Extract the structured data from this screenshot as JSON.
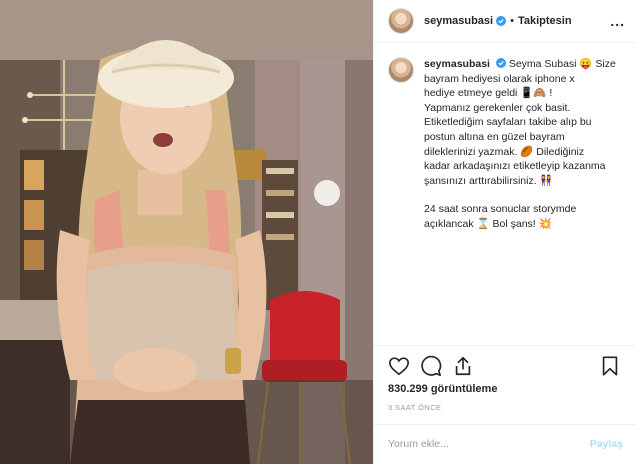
{
  "post": {
    "username": "seymasubasi",
    "separator": "•",
    "follow_label": "Takiptesin",
    "more_label": "...",
    "icons": {
      "verified": "verified-badge-icon",
      "like": "heart-icon",
      "comment": "comment-bubble-icon",
      "share": "share-icon",
      "save": "bookmark-icon",
      "more": "ellipsis-icon"
    }
  },
  "caption": {
    "username": "seymasubasi",
    "lines": [
      "Seyma Subasi 😛 Size",
      "bayram hediyesi olarak iphone x",
      "hediye etmeye geldi 📱🙈 !",
      "Yapmanız gerekenler çok basit.",
      "Etiketlediğim sayfaları takibe alıp bu",
      "postun altına en güzel bayram",
      "dileklerinizi yazmak. 🏉 Dilediğiniz",
      "kadar arkadaşınızı etiketleyip kazanma",
      "şansınızı arttırabilirsiniz. 👭"
    ],
    "lines2": [
      "24 saat sonra sonuclar storymde",
      "açıklancak ⌛ Bol şans! 💥"
    ]
  },
  "stats": {
    "views": "830.299 görüntüleme",
    "time": "3 SAAT ÖNCE"
  },
  "comment": {
    "placeholder": "Yorum ekle...",
    "share_label": "Paylaş"
  },
  "colors": {
    "verified_blue": "#3897f0",
    "share_disabled": "#b2dffc",
    "muted": "#999999"
  }
}
